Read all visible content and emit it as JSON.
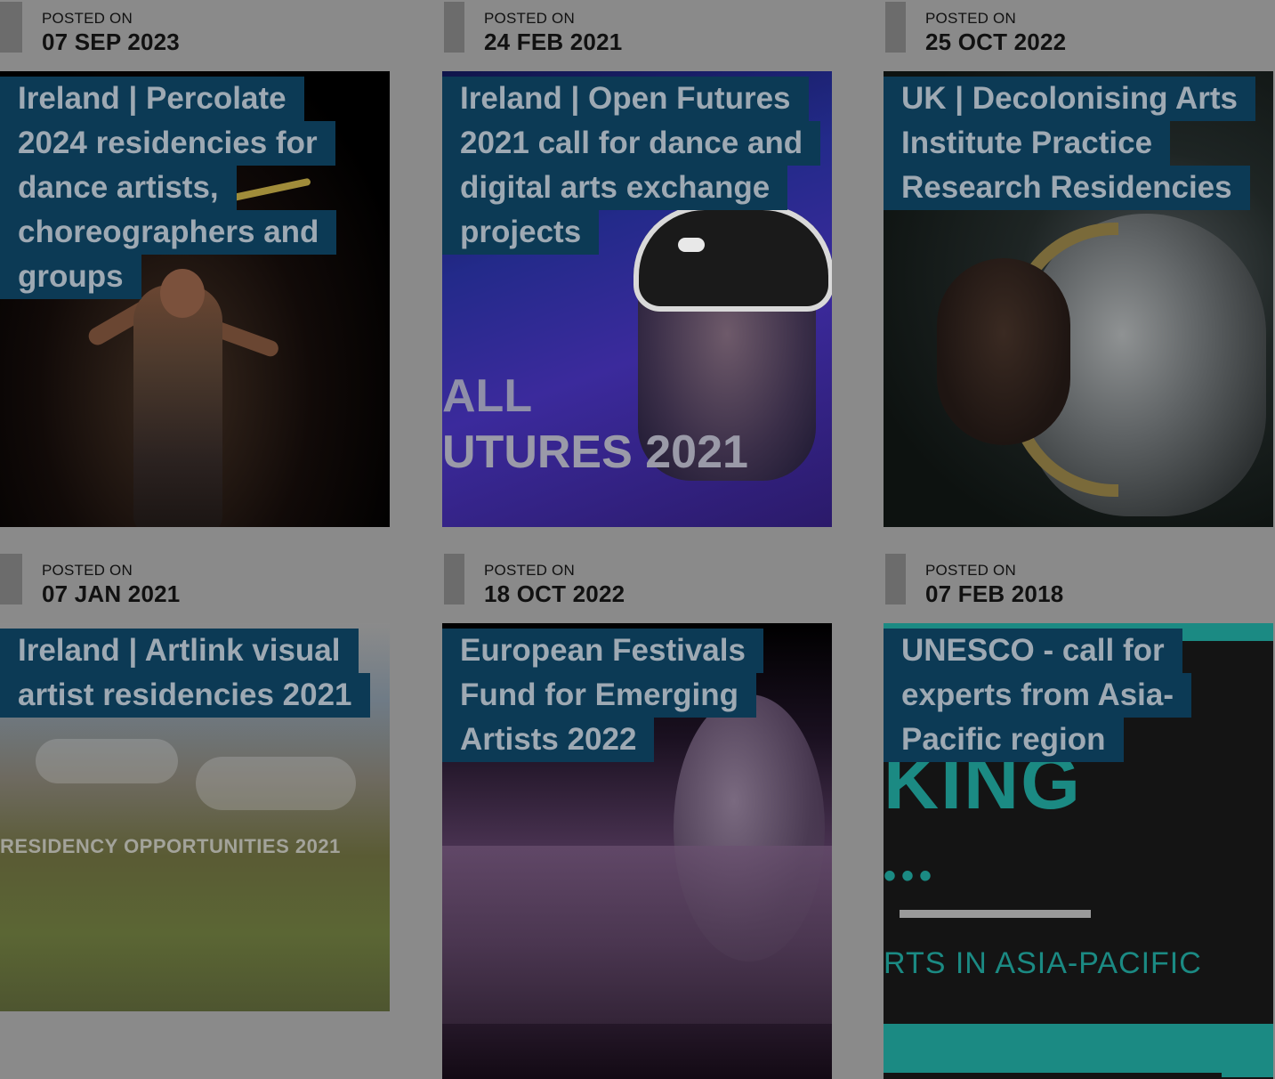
{
  "cards": [
    {
      "posted_label": "POSTED ON",
      "date": "07 SEP 2023",
      "title_lines": [
        "Ireland | Percolate",
        "2024 residencies for",
        "dance artists,",
        "choreographers and",
        "groups"
      ]
    },
    {
      "posted_label": "POSTED ON",
      "date": "24 FEB 2021",
      "title_lines": [
        "Ireland | Open Futures",
        "2021 call for dance and",
        "digital arts exchange",
        "projects"
      ],
      "image_text": [
        "ALL",
        "UTURES 2021"
      ]
    },
    {
      "posted_label": "POSTED ON",
      "date": "25 OCT 2022",
      "title_lines": [
        "UK | Decolonising Arts",
        "Institute Practice",
        "Research Residencies"
      ]
    },
    {
      "posted_label": "POSTED ON",
      "date": "07 JAN 2021",
      "title_lines": [
        "Ireland | Artlink visual",
        "artist residencies 2021"
      ],
      "image_text": [
        "RESIDENCY OPPORTUNITIES 2021"
      ]
    },
    {
      "posted_label": "POSTED ON",
      "date": "18 OCT 2022",
      "title_lines": [
        "European Festivals",
        "Fund for Emerging",
        "Artists 2022"
      ]
    },
    {
      "posted_label": "POSTED ON",
      "date": "07 FEB 2018",
      "title_lines": [
        "UNESCO - call for",
        "experts from Asia-",
        "Pacific region"
      ],
      "image_text": [
        "KING",
        "•••",
        "RTS IN ASIA-PACIFIC"
      ]
    }
  ]
}
